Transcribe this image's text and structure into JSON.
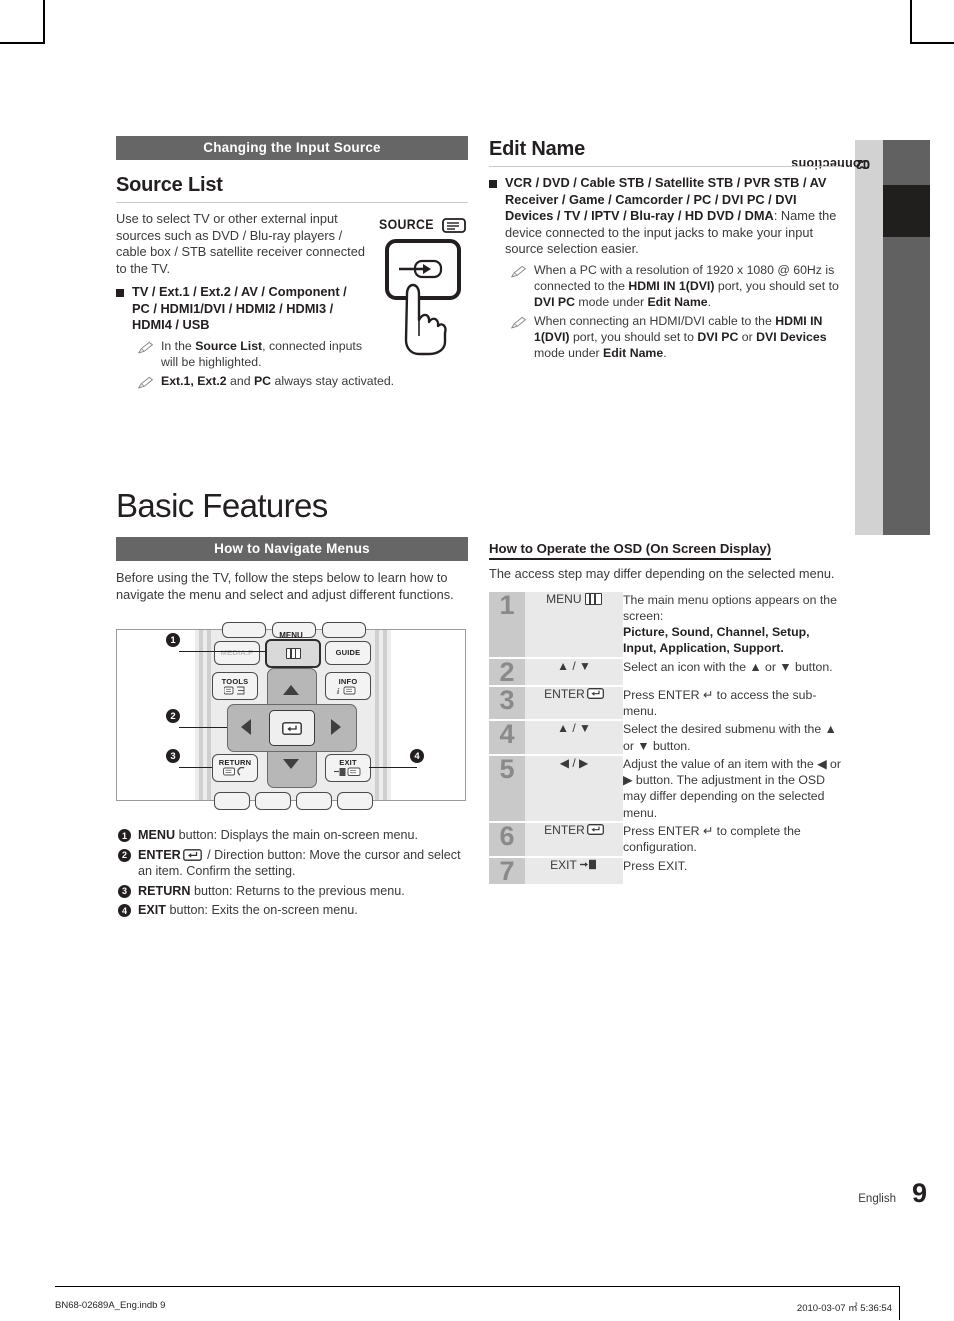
{
  "index_tab": {
    "chapter_number": "02",
    "chapter_name": "Connections"
  },
  "left_column": {
    "section_bar": "Changing the Input Source",
    "heading": "Source List",
    "intro": "Use to select TV or other external input sources such as DVD / Blu-ray players / cable box / STB satellite receiver connected to the TV.",
    "bullet_bold": "TV / Ext.1 / Ext.2 / AV / Component / PC / HDMI1/DVI / HDMI2 / HDMI3 / HDMI4 / USB",
    "notes": [
      {
        "pre": "In the ",
        "b1": "Source List",
        "post": ", connected inputs will be highlighted."
      },
      {
        "pre": "",
        "b1": "Ext.1, Ext.2",
        "mid": " and ",
        "b2": "PC",
        "post": " always stay activated."
      }
    ],
    "source_key_label": "SOURCE"
  },
  "right_column": {
    "heading": "Edit Name",
    "bullet_bold": "VCR / DVD / Cable STB / Satellite STB / PVR STB / AV Receiver / Game / Camcorder / PC / DVI PC / DVI Devices / TV / IPTV / Blu-ray / HD DVD / DMA",
    "bullet_rest": ": Name the device connected to the input jacks to make your input source selection easier.",
    "notes": [
      {
        "p1": "When a PC with a resolution of 1920 x 1080 @ 60Hz is connected to the ",
        "b1": "HDMI IN 1(DVI)",
        "p2": " port, you should set to ",
        "b2": "DVI PC",
        "p3": " mode under ",
        "b3": "Edit Name",
        "p4": "."
      },
      {
        "p1": "When connecting an HDMI/DVI cable to the ",
        "b1": "HDMI IN 1(DVI)",
        "p2": " port, you should set to ",
        "b2": "DVI PC",
        "p3": " or ",
        "b3": "DVI Devices",
        "p4": " mode under ",
        "b4": "Edit Name",
        "p5": "."
      }
    ]
  },
  "basic_features": {
    "title": "Basic Features",
    "section_bar": "How to Navigate Menus",
    "intro": "Before using the TV, follow the steps below to learn how to navigate the menu and select and adjust different functions.",
    "remote_buttons": {
      "menu": "MENU",
      "guide": "GUIDE",
      "tools": "TOOLS",
      "info": "INFO",
      "return": "RETURN",
      "exit": "EXIT"
    },
    "callout_numbers": [
      "1",
      "2",
      "3",
      "4"
    ],
    "callouts": [
      {
        "n": "1",
        "b": "MENU",
        "t": " button: Displays the main on-screen menu."
      },
      {
        "n": "2",
        "b": "ENTER",
        "t2": " / Direction button: Move the cursor and select an item. Confirm the setting."
      },
      {
        "n": "3",
        "b": "RETURN",
        "t": " button: Returns to the previous menu."
      },
      {
        "n": "4",
        "b": "EXIT",
        "t": " button: Exits the on-screen menu."
      }
    ]
  },
  "osd": {
    "heading": "How to Operate the OSD (On Screen Display)",
    "subtitle": "The access step may differ depending on the selected menu.",
    "rows": [
      {
        "num": "1",
        "button": "MENU",
        "button_icon": "menu-icon",
        "desc_plain": "The main menu options appears on the screen:",
        "desc_bold": "Picture, Sound, Channel, Setup, Input, Application, Support."
      },
      {
        "num": "2",
        "button": "▲ / ▼",
        "button_icon": "",
        "desc_plain": "Select an icon with the ▲ or ▼ button.",
        "desc_bold": ""
      },
      {
        "num": "3",
        "button": "ENTER",
        "button_icon": "enter-icon",
        "desc_plain": "Press ENTER ↵ to access the sub-menu.",
        "desc_bold": ""
      },
      {
        "num": "4",
        "button": "▲ / ▼",
        "button_icon": "",
        "desc_plain": "Select the desired submenu with the ▲ or ▼ button.",
        "desc_bold": ""
      },
      {
        "num": "5",
        "button": "◀ / ▶",
        "button_icon": "",
        "desc_plain": "Adjust the value of an item with the ◀ or ▶ button. The adjustment in the OSD may differ depending on the selected menu.",
        "desc_bold": ""
      },
      {
        "num": "6",
        "button": "ENTER",
        "button_icon": "enter-icon",
        "desc_plain": "Press ENTER ↵ to complete the configuration.",
        "desc_bold": ""
      },
      {
        "num": "7",
        "button": "EXIT",
        "button_icon": "exit-icon",
        "desc_plain": "Press EXIT.",
        "desc_bold": ""
      }
    ]
  },
  "footer": {
    "language": "English",
    "page_number": "9",
    "file_ref": "BN68-02689A_Eng.indb   9",
    "timestamp": "2010-03-07   ㎡ 5:36:54"
  },
  "colors": {
    "bar_gray": "#666666",
    "tab_light": "#d2d2d2",
    "tab_dark": "#616161",
    "tab_black": "#211e1e",
    "table_num_bg": "#c9c9c9",
    "table_btn_bg": "#e9e9e9"
  }
}
